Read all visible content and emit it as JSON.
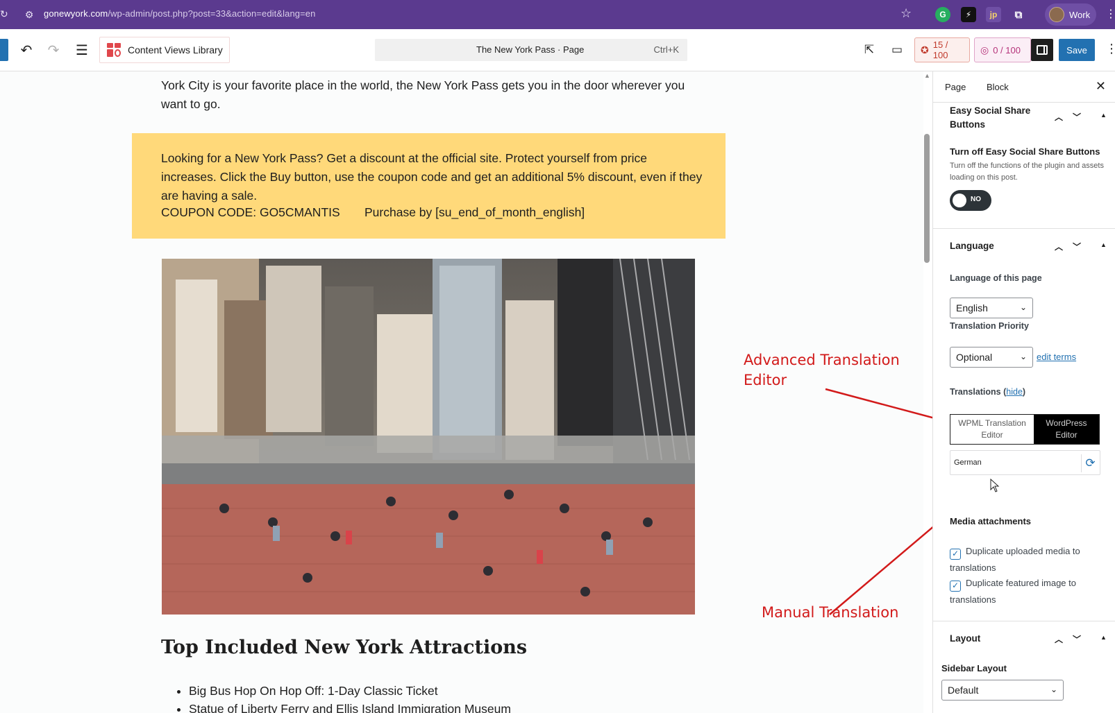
{
  "browser": {
    "url_host": "gonewyork.com",
    "url_path": "/wp-admin/post.php?post=33&action=edit&lang=en",
    "profile_label": "Work"
  },
  "toolbar": {
    "library_label": "Content Views Library",
    "command_title": "The New York Pass · Page",
    "command_shortcut": "Ctrl+K",
    "score1": "15 / 100",
    "score2": "0 / 100",
    "save_label": "Save"
  },
  "editor": {
    "top_paragraph": "York City is your favorite place in the world, the New York Pass gets you in the door wherever you want to go.",
    "promo_text": "Looking for a New York Pass? Get a discount at the official site. Protect yourself from price increases. Click the Buy button, use the coupon code and get an additional 5% discount, even if they are having a ",
    "promo_sale": "sale",
    "promo_end": ".",
    "coupon": "COUPON CODE: GO5CMANTIS",
    "purchase": "Purchase by [su_end_of_month_english]",
    "heading": "Top Included New York Attractions",
    "bullets": [
      "Big Bus Hop On Hop Off: 1-Day Classic Ticket",
      "Statue of Liberty Ferry and Ellis Island Immigration Museum"
    ]
  },
  "annotations": {
    "advanced_line1": "Advanced Translation",
    "advanced_line2": "Editor",
    "manual": "Manual Translation"
  },
  "panel": {
    "tab_page": "Page",
    "tab_block": "Block",
    "social_title_1": "Easy Social Share",
    "social_title_2": "Buttons",
    "social_sub": "Turn off Easy Social Share Buttons",
    "social_help": "Turn off the functions of the plugin and assets loading on this post.",
    "toggle_label": "NO",
    "language_title": "Language",
    "language_of_page_label": "Language of this page",
    "language_value": "English",
    "priority_label": "Translation Priority",
    "priority_value": "Optional",
    "edit_terms": "edit terms",
    "translations_label": "Translations",
    "hide_link": "hide",
    "wpml_line1": "WPML Translation",
    "wpml_line2": "Editor",
    "wp_line1": "WordPress",
    "wp_line2": "Editor",
    "german": "German",
    "media_title": "Media attachments",
    "dup_media_1": "Duplicate uploaded media to",
    "dup_media_2": "translations",
    "dup_featured_1": "Duplicate featured image to",
    "dup_featured_2": "translations",
    "layout_title": "Layout",
    "sidebar_layout_label": "Sidebar Layout",
    "sidebar_layout_value": "Default"
  },
  "colors": {
    "browser_bar": "#5b3a8f",
    "accent": "#2271b1",
    "promo_bg": "#ffd97a",
    "annotation_red": "#d21a1a"
  }
}
